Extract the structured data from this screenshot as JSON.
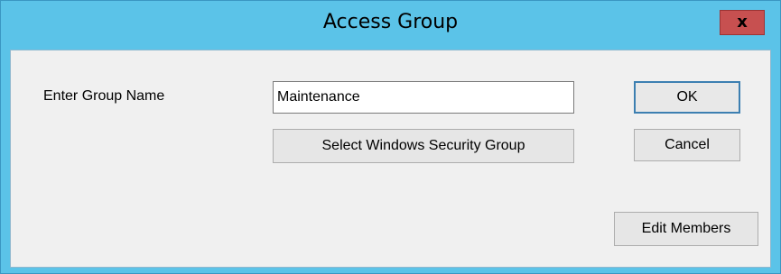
{
  "window": {
    "title": "Access Group",
    "close_icon": "close-icon",
    "close_glyph": "x"
  },
  "form": {
    "group_name_label": "Enter Group Name",
    "group_name_value": "Maintenance"
  },
  "buttons": {
    "ok": "OK",
    "cancel": "Cancel",
    "select_security_group": "Select Windows Security Group",
    "edit_members": "Edit Members"
  },
  "colors": {
    "titlebar": "#5bc3e8",
    "close_button": "#c75050",
    "client_background": "#f0f0f0",
    "default_button_border": "#3c7fb1"
  }
}
